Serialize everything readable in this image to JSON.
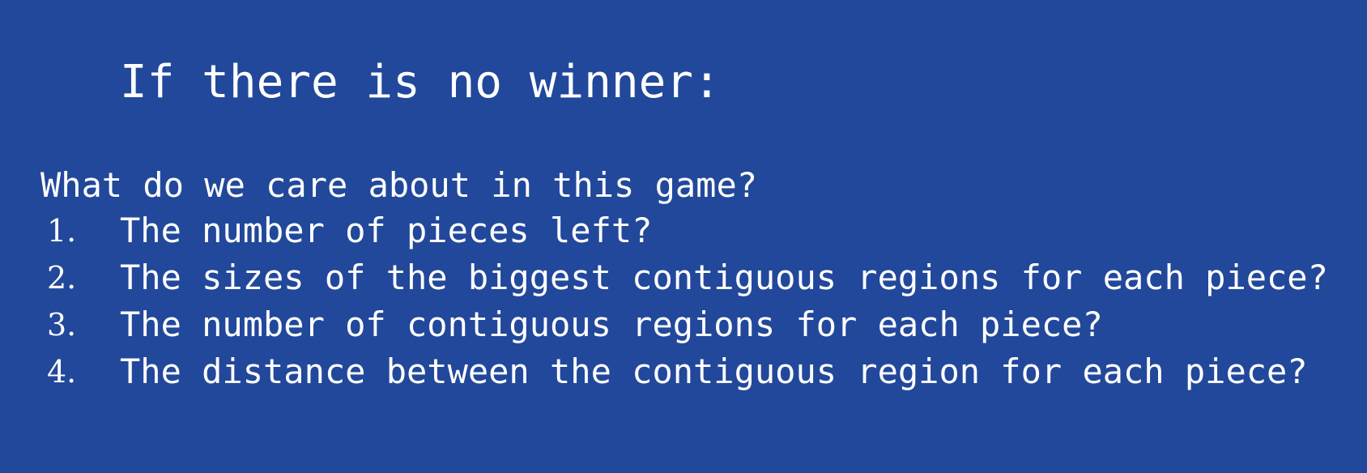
{
  "slide": {
    "background_color": "#22489b",
    "text_color": "#ffffff",
    "title": "If there is no winner:",
    "intro": "What do we care about in this game?",
    "items": [
      {
        "number": "1.",
        "text": "The number of pieces left?"
      },
      {
        "number": "2.",
        "text": "The sizes of the biggest contiguous regions for each piece?"
      },
      {
        "number": "3.",
        "text": "The number of contiguous regions for each piece?"
      },
      {
        "number": "4.",
        "text": "The distance between the contiguous region for each piece?"
      }
    ]
  }
}
